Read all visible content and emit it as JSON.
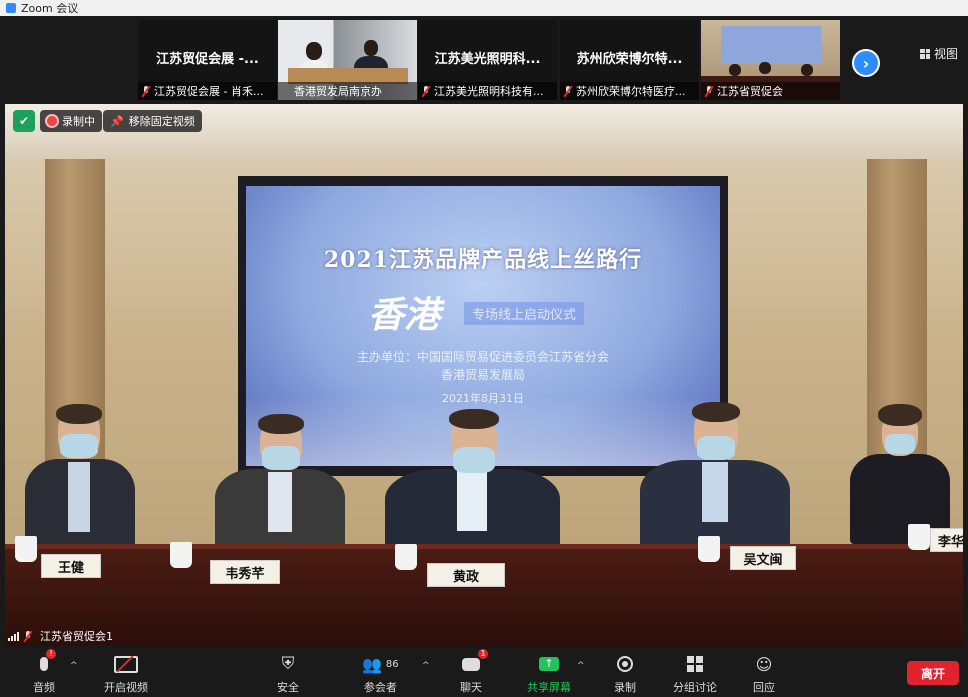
{
  "window": {
    "title": "Zoom 会议"
  },
  "participants_strip": {
    "tiles": [
      {
        "name": "江苏贸促会展 -...",
        "caption": "江苏贸促会展 - 肖禾..."
      },
      {
        "name": "",
        "caption": "香港贸发局南京办"
      },
      {
        "name": "江苏美光照明科...",
        "caption": "江苏美光照明科技有..."
      },
      {
        "name": "苏州欣荣博尔特...",
        "caption": "苏州欣荣博尔特医疗..."
      },
      {
        "name": "",
        "caption": "江苏省贸促会"
      }
    ],
    "next_icon": "chevron-right-icon",
    "view_label": "视图"
  },
  "overlay": {
    "recording_label": "录制中",
    "unpin_label": "移除固定视频",
    "security_icon": "shield-check-icon"
  },
  "main_video": {
    "speaker_name": "江苏省贸促会1",
    "screen": {
      "title": "2021江苏品牌产品线上丝路行",
      "hk": "香港",
      "subtitle": "专场线上启动仪式",
      "organizers_line1": "主办单位：中国国际贸易促进委员会江苏省分会",
      "organizers_line2": "香港贸易发展局",
      "date": "2021年8月31日"
    },
    "nameplates": [
      "王健",
      "韦秀芊",
      "黄政",
      "吴文闽",
      "李华"
    ]
  },
  "toolbar": {
    "audio": {
      "label": "音频",
      "badge": "!"
    },
    "video": {
      "label": "开启视频"
    },
    "security": {
      "label": "安全"
    },
    "participants": {
      "label": "参会者",
      "count": "86"
    },
    "chat": {
      "label": "聊天",
      "badge": "1"
    },
    "share": {
      "label": "共享屏幕"
    },
    "record": {
      "label": "录制"
    },
    "breakout": {
      "label": "分组讨论"
    },
    "reactions": {
      "label": "回应"
    },
    "leave": {
      "label": "离开"
    }
  },
  "colors": {
    "accent": "#2d8cff",
    "leave": "#e0242e",
    "share": "#22c35a",
    "badge": "#e02828"
  }
}
